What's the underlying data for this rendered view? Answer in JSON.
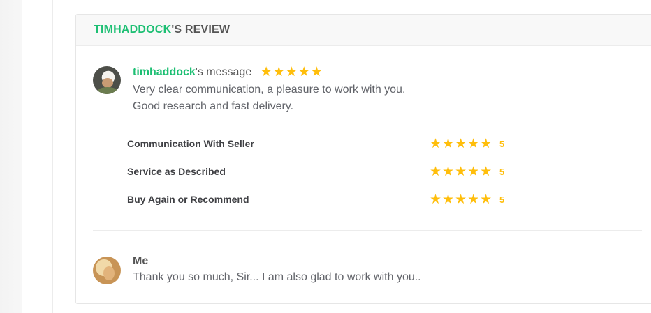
{
  "review": {
    "header_user": "TIMHADDOCK",
    "header_suffix": "'S REVIEW",
    "message_user": "timhaddock",
    "message_suffix": "'s message",
    "overall_stars": 5,
    "body_line1": "Very clear communication, a pleasure to work with you.",
    "body_line2": "Good research and fast delivery.",
    "ratings": [
      {
        "label": "Communication With Seller",
        "stars": 5,
        "score": "5"
      },
      {
        "label": "Service as Described",
        "stars": 5,
        "score": "5"
      },
      {
        "label": "Buy Again or Recommend",
        "stars": 5,
        "score": "5"
      }
    ]
  },
  "reply": {
    "name": "Me",
    "text": "Thank you so much, Sir... I am also glad to work with you.."
  },
  "colors": {
    "accent_green": "#1dbf73",
    "star_gold": "#ffbe0b",
    "text_gray": "#62646a"
  }
}
